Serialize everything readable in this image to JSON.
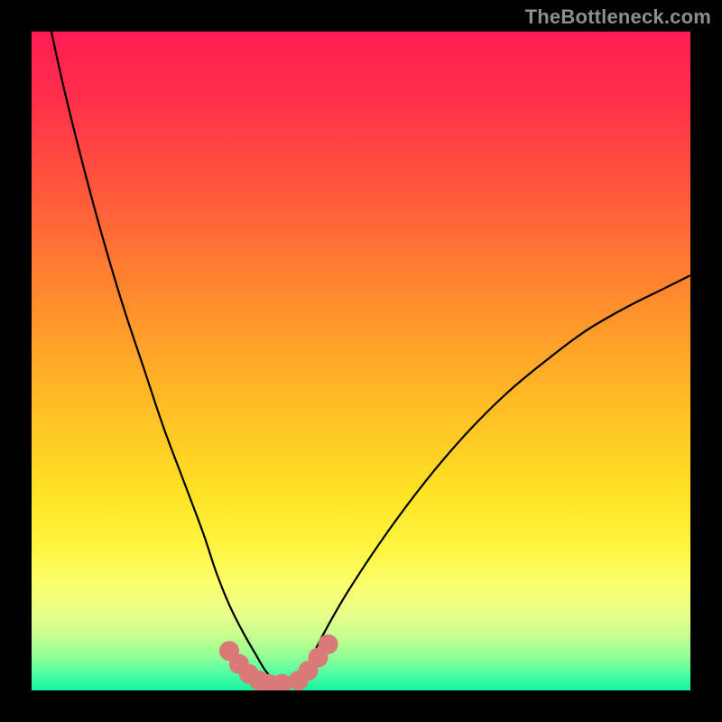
{
  "watermark": "TheBottleneck.com",
  "chart_data": {
    "type": "line",
    "title": "",
    "xlabel": "",
    "ylabel": "",
    "xlim": [
      0,
      100
    ],
    "ylim": [
      0,
      100
    ],
    "series": [
      {
        "name": "bottleneck-curve",
        "x": [
          3,
          5,
          8,
          11,
          14,
          17,
          20,
          23,
          26,
          28,
          30,
          32,
          34,
          35.5,
          37,
          38.5,
          40,
          42,
          44,
          48,
          54,
          60,
          66,
          72,
          78,
          84,
          90,
          96,
          100
        ],
        "y": [
          100,
          91,
          79,
          68,
          58,
          49,
          40,
          32,
          24,
          18,
          13,
          9,
          5.5,
          3,
          1.5,
          1,
          1.5,
          4,
          8,
          15,
          24,
          32,
          39,
          45,
          50,
          54.5,
          58,
          61,
          63
        ]
      },
      {
        "name": "bottom-dots",
        "x": [
          30,
          31.5,
          33,
          34.5,
          36,
          38,
          40.5,
          42,
          43.5,
          45
        ],
        "y": [
          6,
          4,
          2.5,
          1.5,
          1,
          1,
          1.5,
          3,
          5,
          7
        ]
      }
    ],
    "gradient_stops": [
      {
        "offset": 0.0,
        "color": "#ff1d53"
      },
      {
        "offset": 0.1,
        "color": "#ff2f4b"
      },
      {
        "offset": 0.25,
        "color": "#ff5a3a"
      },
      {
        "offset": 0.4,
        "color": "#ff8a2e"
      },
      {
        "offset": 0.55,
        "color": "#ffb825"
      },
      {
        "offset": 0.7,
        "color": "#ffe225"
      },
      {
        "offset": 0.78,
        "color": "#fff43f"
      },
      {
        "offset": 0.84,
        "color": "#fbff6e"
      },
      {
        "offset": 0.885,
        "color": "#e8ff8a"
      },
      {
        "offset": 0.92,
        "color": "#c2ff8f"
      },
      {
        "offset": 0.95,
        "color": "#8fff96"
      },
      {
        "offset": 0.975,
        "color": "#4dffa4"
      },
      {
        "offset": 1.0,
        "color": "#17f3a0"
      }
    ],
    "dot_color": "#d97a78",
    "curve_color": "#000000"
  }
}
